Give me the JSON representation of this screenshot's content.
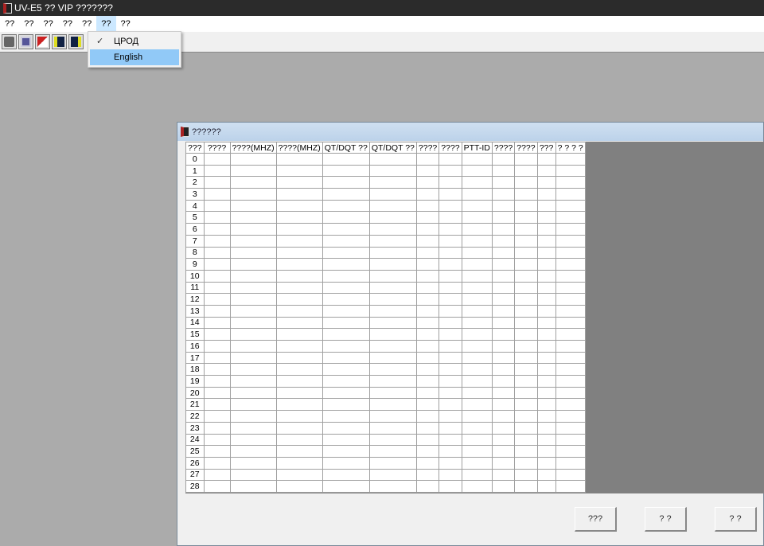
{
  "app": {
    "title": "UV-E5 ?? VIP ???????"
  },
  "menu": [
    "??",
    "??",
    "??",
    "??",
    "??",
    "??",
    "??"
  ],
  "language_menu": {
    "items": [
      {
        "label": "ЦРОД",
        "checked": true
      },
      {
        "label": "English",
        "highlighted": true
      }
    ]
  },
  "toolbar": {
    "icons": [
      "read-radio-icon",
      "save-icon",
      "open-icon",
      "read-icon",
      "write-icon"
    ]
  },
  "channel_window": {
    "title": "??????",
    "columns": [
      "???",
      "????",
      "????(MHZ)",
      "????(MHZ)",
      "QT/DQT ??",
      "QT/DQT ??",
      "????",
      "????",
      "PTT-ID",
      "????",
      "????",
      "???",
      "? ? ? ?"
    ],
    "rows": [
      "0",
      "1",
      "2",
      "3",
      "4",
      "5",
      "6",
      "7",
      "8",
      "9",
      "10",
      "11",
      "12",
      "13",
      "14",
      "15",
      "16",
      "17",
      "18",
      "19",
      "20",
      "21",
      "22",
      "23",
      "24",
      "25",
      "26",
      "27",
      "28"
    ],
    "buttons": [
      "???",
      "? ?",
      "? ?"
    ]
  }
}
